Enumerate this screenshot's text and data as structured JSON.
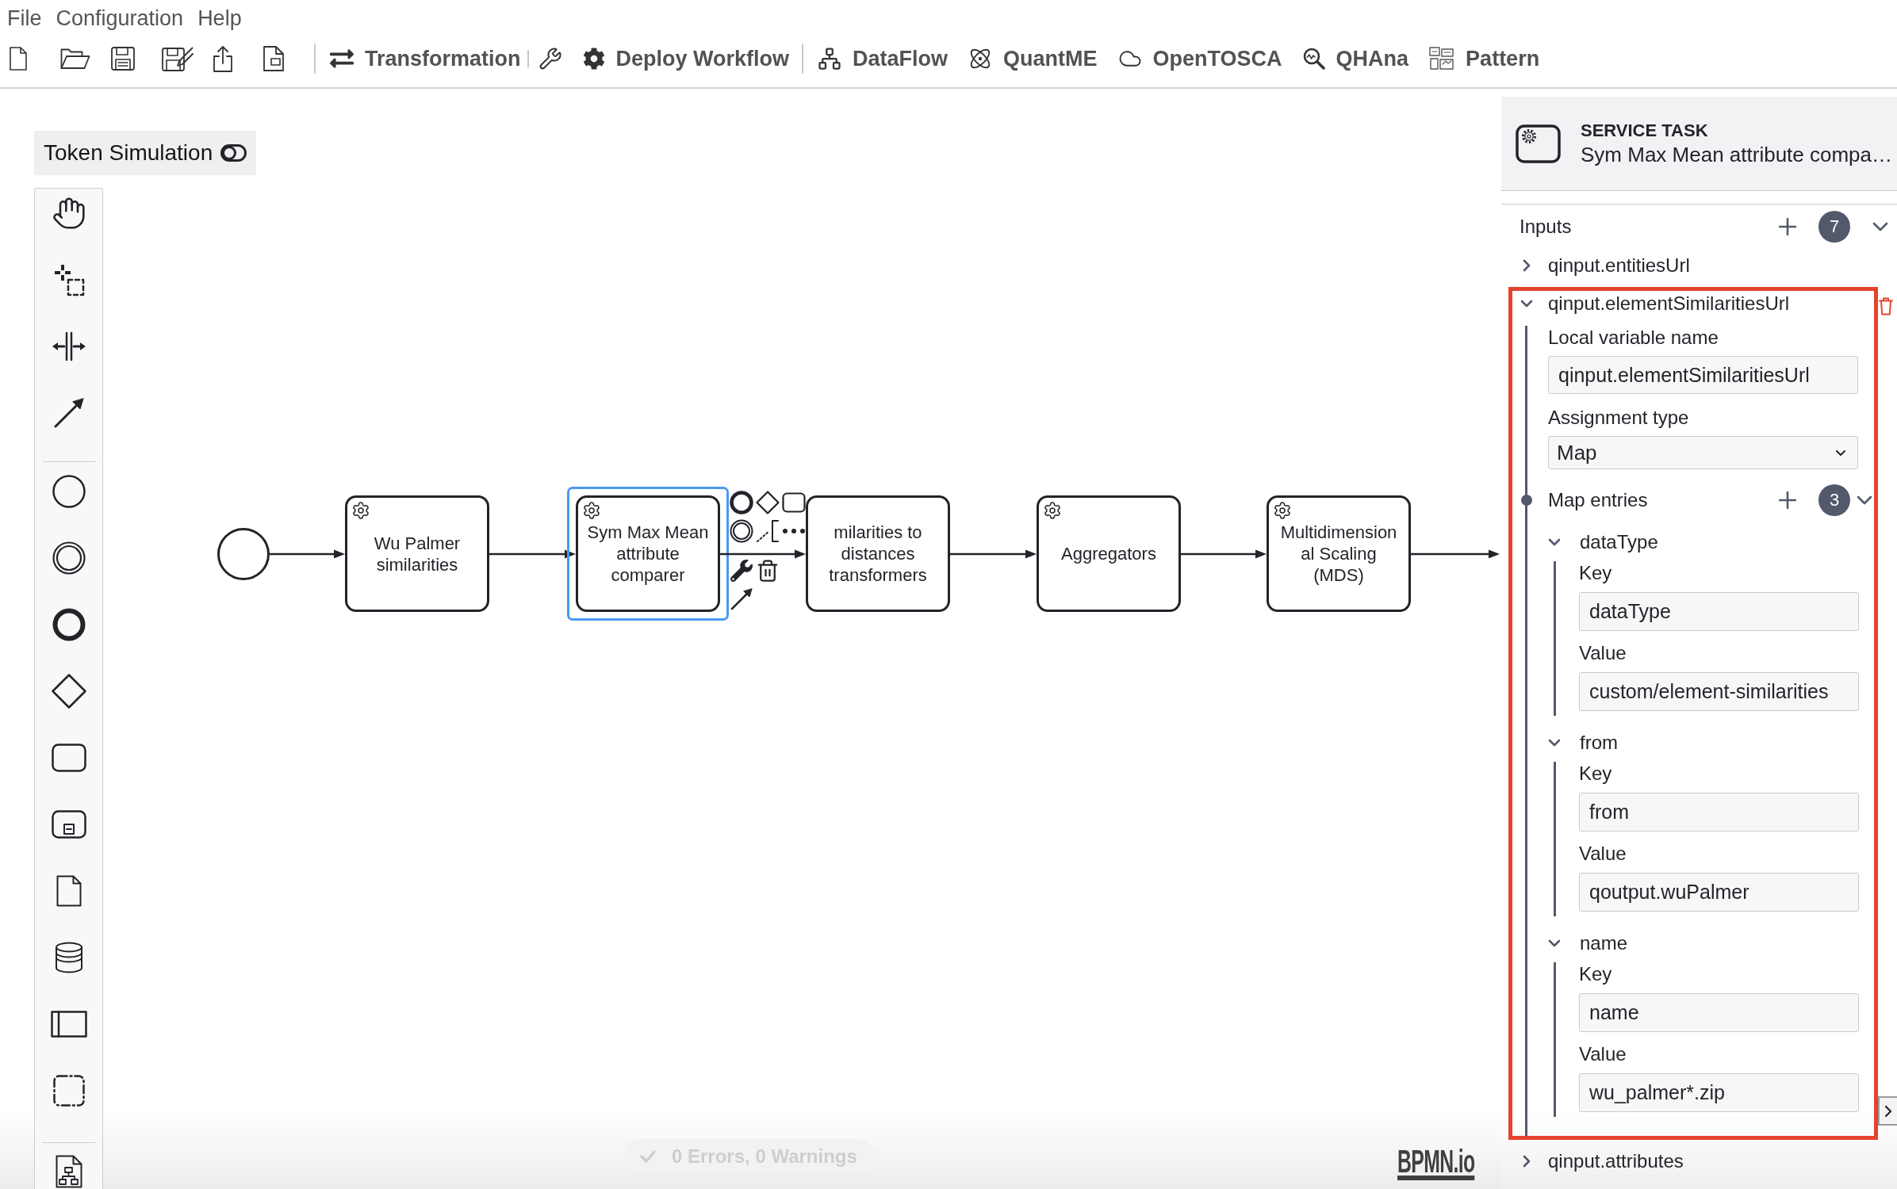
{
  "menu_bar": {
    "items": [
      "File",
      "Configuration",
      "Help"
    ]
  },
  "toolbar": {
    "buttons": [
      {
        "label": "Transformation"
      },
      {
        "label": "Deploy Workflow"
      },
      {
        "label": "DataFlow"
      },
      {
        "label": "QuantME"
      },
      {
        "label": "OpenTOSCA"
      },
      {
        "label": "QHAna"
      },
      {
        "label": "Pattern"
      }
    ]
  },
  "token_simulation": {
    "label": "Token Simulation",
    "on": false
  },
  "diagram": {
    "nodes": [
      {
        "kind": "start_event",
        "selected": false
      },
      {
        "kind": "service_task",
        "label": [
          "Wu Palmer",
          "similarities"
        ],
        "selected": false
      },
      {
        "kind": "service_task",
        "label": [
          "Sym Max Mean",
          "attribute",
          "comparer"
        ],
        "selected": true
      },
      {
        "kind": "task",
        "label": [
          "milarities to",
          "distances",
          "transformers"
        ],
        "selected": false
      },
      {
        "kind": "service_task",
        "label": [
          "Aggregators"
        ],
        "selected": false
      },
      {
        "kind": "service_task",
        "label": [
          "Multidimension",
          "al Scaling",
          "(MDS)"
        ],
        "selected": false
      }
    ]
  },
  "status": {
    "text": "0 Errors, 0 Warnings"
  },
  "logo": {
    "text": "BPMN.io"
  },
  "properties_panel": {
    "header": {
      "type": "SERVICE TASK",
      "name": "Sym Max Mean attribute compa…"
    },
    "inputs": {
      "title": "Inputs",
      "count": "7",
      "expanded": true,
      "items": [
        {
          "name": "qinput.entitiesUrl",
          "expanded": false,
          "highlighted": false
        },
        {
          "name": "qinput.elementSimilaritiesUrl",
          "expanded": true,
          "highlighted": true,
          "local_variable_name": {
            "label": "Local variable name",
            "value": "qinput.elementSimilaritiesUrl"
          },
          "assignment_type": {
            "label": "Assignment type",
            "value": "Map"
          },
          "map_entries": {
            "title": "Map entries",
            "count": "3",
            "expanded": true,
            "entries": [
              {
                "name": "dataType",
                "expanded": true,
                "key": {
                  "label": "Key",
                  "value": "dataType"
                },
                "value": {
                  "label": "Value",
                  "value": "custom/element-similarities"
                }
              },
              {
                "name": "from",
                "expanded": true,
                "key": {
                  "label": "Key",
                  "value": "from"
                },
                "value": {
                  "label": "Value",
                  "value": "qoutput.wuPalmer"
                }
              },
              {
                "name": "name",
                "expanded": true,
                "key": {
                  "label": "Key",
                  "value": "name"
                },
                "value": {
                  "label": "Value",
                  "value": "wu_palmer*.zip"
                }
              }
            ]
          }
        },
        {
          "name": "qinput.attributes",
          "expanded": false,
          "highlighted": false
        }
      ]
    }
  }
}
